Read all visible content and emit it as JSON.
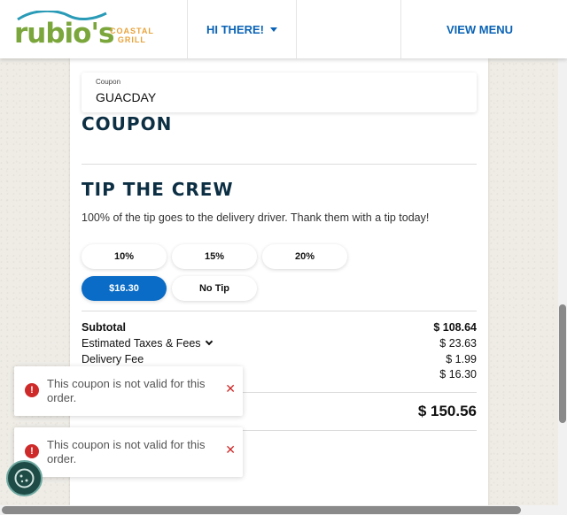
{
  "header": {
    "logo_text": "rubio's",
    "logo_sub_1": "COASTAL",
    "logo_sub_2": "GRILL",
    "greeting": "HI THERE!",
    "view_menu": "VIEW MENU"
  },
  "coupon": {
    "field_label": "Coupon",
    "field_value": "GUACDAY",
    "heading": "COUPON"
  },
  "tip": {
    "heading": "TIP THE CREW",
    "description": "100% of the tip goes to the delivery driver. Thank them with a tip today!",
    "options": [
      "10%",
      "15%",
      "20%",
      "$16.30",
      "No Tip"
    ],
    "selected": "$16.30"
  },
  "summary": {
    "subtotal_label": "Subtotal",
    "subtotal_value": "$ 108.64",
    "taxes_label": "Estimated Taxes & Fees",
    "taxes_value": "$ 23.63",
    "delivery_label": "Delivery Fee",
    "delivery_value": "$ 1.99",
    "tip_value": "$ 16.30",
    "total_value": "$ 150.56"
  },
  "toasts": [
    {
      "message": "This coupon is not valid for this order."
    },
    {
      "message": "This coupon is not valid for this order."
    }
  ],
  "colors": {
    "brand_blue": "#0a6cc6",
    "heading_navy": "#0d2f44",
    "logo_green": "#7aa63c",
    "error_red": "#cf2a2a"
  }
}
